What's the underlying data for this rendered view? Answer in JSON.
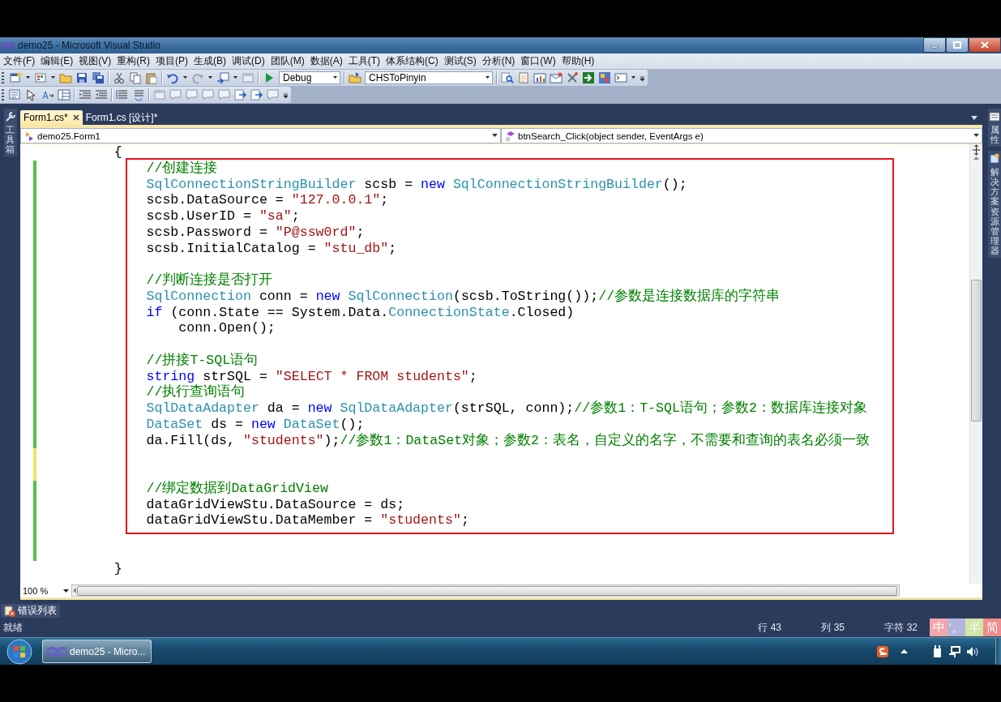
{
  "window": {
    "title": "demo25 - Microsoft Visual Studio"
  },
  "menu": [
    "文件(F)",
    "编辑(E)",
    "视图(V)",
    "重构(R)",
    "项目(P)",
    "生成(B)",
    "调试(D)",
    "团队(M)",
    "数据(A)",
    "工具(T)",
    "体系结构(C)",
    "测试(S)",
    "分析(N)",
    "窗口(W)",
    "帮助(H)"
  ],
  "toolbar": {
    "configuration": "Debug",
    "startup_item": "CHSToPinyin"
  },
  "left_dock": [
    {
      "label": "工具箱"
    }
  ],
  "right_dock": [
    {
      "label": "属性"
    },
    {
      "label": "解决方案资源管理器"
    }
  ],
  "document_tabs": [
    {
      "label": "Form1.cs*",
      "selected": true
    },
    {
      "label": "Form1.cs [设计]*",
      "selected": false
    }
  ],
  "navigation": {
    "type_list": "demo25.Form1",
    "member_list": "btnSearch_Click(object sender, EventArgs e)"
  },
  "code": {
    "lines": [
      {
        "changed": false,
        "segments": [
          {
            "kind": "plain",
            "text": "        {"
          }
        ]
      },
      {
        "changed": true,
        "saved": true,
        "segments": [
          {
            "kind": "comment",
            "text": "            //创建连接"
          }
        ]
      },
      {
        "changed": true,
        "saved": true,
        "segments": [
          {
            "kind": "type",
            "text": "            SqlConnectionStringBuilder"
          },
          {
            "kind": "plain",
            "text": " scsb = "
          },
          {
            "kind": "keyword",
            "text": "new"
          },
          {
            "kind": "type",
            "text": " SqlConnectionStringBuilder"
          },
          {
            "kind": "plain",
            "text": "();"
          }
        ]
      },
      {
        "changed": true,
        "saved": true,
        "segments": [
          {
            "kind": "plain",
            "text": "            scsb.DataSource = "
          },
          {
            "kind": "string",
            "text": "\"127.0.0.1\""
          },
          {
            "kind": "plain",
            "text": ";"
          }
        ]
      },
      {
        "changed": true,
        "saved": true,
        "segments": [
          {
            "kind": "plain",
            "text": "            scsb.UserID = "
          },
          {
            "kind": "string",
            "text": "\"sa\""
          },
          {
            "kind": "plain",
            "text": ";"
          }
        ]
      },
      {
        "changed": true,
        "saved": true,
        "segments": [
          {
            "kind": "plain",
            "text": "            scsb.Password = "
          },
          {
            "kind": "string",
            "text": "\"P@ssw0rd\""
          },
          {
            "kind": "plain",
            "text": ";"
          }
        ]
      },
      {
        "changed": true,
        "saved": true,
        "segments": [
          {
            "kind": "plain",
            "text": "            scsb.InitialCatalog = "
          },
          {
            "kind": "string",
            "text": "\"stu_db\""
          },
          {
            "kind": "plain",
            "text": ";"
          }
        ]
      },
      {
        "changed": true,
        "saved": true
      },
      {
        "changed": true,
        "saved": true,
        "segments": [
          {
            "kind": "comment",
            "text": "            //判断连接是否打开"
          }
        ]
      },
      {
        "changed": true,
        "saved": true,
        "segments": [
          {
            "kind": "type",
            "text": "            SqlConnection"
          },
          {
            "kind": "plain",
            "text": " conn = "
          },
          {
            "kind": "keyword",
            "text": "new"
          },
          {
            "kind": "type",
            "text": " SqlConnection"
          },
          {
            "kind": "plain",
            "text": "(scsb.ToString());"
          },
          {
            "kind": "comment",
            "text": "//参数是连接数据库的字符串"
          }
        ]
      },
      {
        "changed": true,
        "saved": true,
        "segments": [
          {
            "kind": "keyword",
            "text": "            if"
          },
          {
            "kind": "plain",
            "text": " (conn.State == System.Data."
          },
          {
            "kind": "type",
            "text": "ConnectionState"
          },
          {
            "kind": "plain",
            "text": ".Closed)"
          }
        ]
      },
      {
        "changed": true,
        "saved": true,
        "segments": [
          {
            "kind": "plain",
            "text": "                conn.Open();"
          }
        ]
      },
      {
        "changed": true,
        "saved": true
      },
      {
        "changed": true,
        "saved": true,
        "segments": [
          {
            "kind": "comment",
            "text": "            //拼接T-SQL语句"
          }
        ]
      },
      {
        "changed": true,
        "saved": true,
        "segments": [
          {
            "kind": "keyword",
            "text": "            string"
          },
          {
            "kind": "plain",
            "text": " strSQL = "
          },
          {
            "kind": "string",
            "text": "\"SELECT * FROM students\""
          },
          {
            "kind": "plain",
            "text": ";"
          }
        ]
      },
      {
        "changed": true,
        "saved": true,
        "segments": [
          {
            "kind": "comment",
            "text": "            //执行查询语句"
          }
        ]
      },
      {
        "changed": true,
        "saved": true,
        "segments": [
          {
            "kind": "type",
            "text": "            SqlDataAdapter"
          },
          {
            "kind": "plain",
            "text": " da = "
          },
          {
            "kind": "keyword",
            "text": "new"
          },
          {
            "kind": "type",
            "text": " SqlDataAdapter"
          },
          {
            "kind": "plain",
            "text": "(strSQL, conn);"
          },
          {
            "kind": "comment",
            "text": "//参数1：T-SQL语句；参数2：数据库连接对象"
          }
        ]
      },
      {
        "changed": true,
        "saved": true,
        "segments": [
          {
            "kind": "type",
            "text": "            DataSet"
          },
          {
            "kind": "plain",
            "text": " ds = "
          },
          {
            "kind": "keyword",
            "text": "new"
          },
          {
            "kind": "type",
            "text": " DataSet"
          },
          {
            "kind": "plain",
            "text": "();"
          }
        ]
      },
      {
        "changed": true,
        "saved": true,
        "segments": [
          {
            "kind": "plain",
            "text": "            da.Fill(ds, "
          },
          {
            "kind": "string",
            "text": "\"students\""
          },
          {
            "kind": "plain",
            "text": ");"
          },
          {
            "kind": "comment",
            "text": "//参数1：DataSet对象；参数2：表名，自定义的名字，不需要和查询的表名必须一致"
          }
        ]
      },
      {
        "changed": true,
        "saved": false
      },
      {
        "changed": true,
        "saved": false
      },
      {
        "changed": true,
        "saved": true,
        "segments": [
          {
            "kind": "comment",
            "text": "            //绑定数据到DataGridView"
          }
        ]
      },
      {
        "changed": true,
        "saved": true,
        "segments": [
          {
            "kind": "plain",
            "text": "            dataGridViewStu.DataSource = ds;"
          }
        ]
      },
      {
        "changed": true,
        "saved": true,
        "segments": [
          {
            "kind": "plain",
            "text": "            dataGridViewStu.DataMember = "
          },
          {
            "kind": "string",
            "text": "\"students\""
          },
          {
            "kind": "plain",
            "text": ";"
          }
        ]
      },
      {
        "changed": true,
        "saved": true
      },
      {
        "changed": true,
        "saved": true
      },
      {
        "changed": false,
        "segments": [
          {
            "kind": "plain",
            "text": "        }"
          }
        ]
      }
    ]
  },
  "zoom": "100 %",
  "bottom_tabs": [
    {
      "label": "错误列表"
    }
  ],
  "status_bar": {
    "message": "就绪",
    "line": "行 43",
    "column": "列 35",
    "char": "字符 32"
  },
  "ime": [
    {
      "label": "中",
      "color": "#f2a6ac"
    },
    {
      "label": "'。",
      "color": "#b4b4dc"
    },
    {
      "label": "半",
      "color": "#cfe6a8"
    },
    {
      "label": "简",
      "color": "#f08c8c"
    }
  ],
  "taskbar": {
    "buttons": [
      {
        "label": "demo25 - Micro...",
        "selected": true
      }
    ]
  }
}
